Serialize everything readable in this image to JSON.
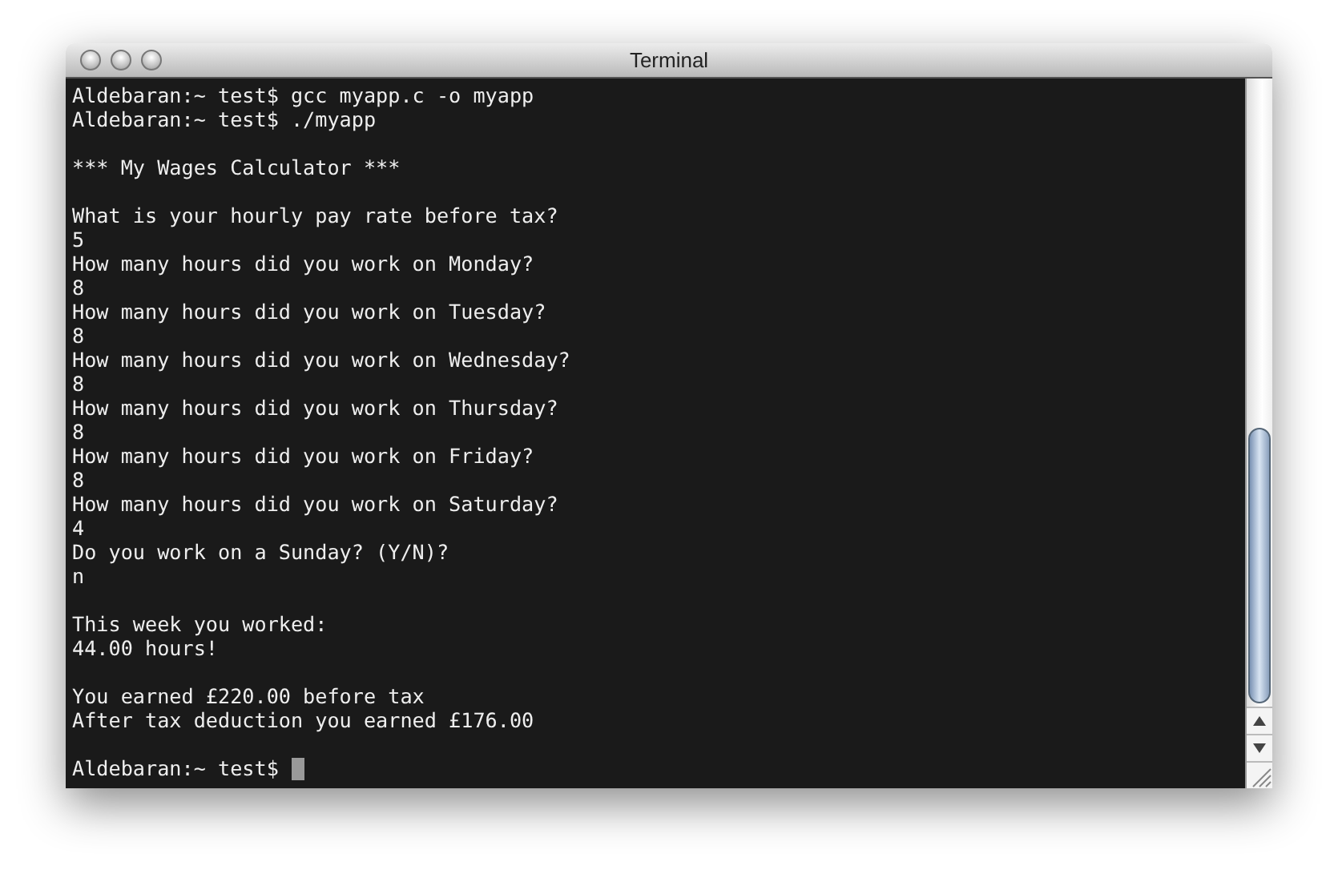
{
  "window": {
    "title": "Terminal"
  },
  "terminal": {
    "blocks": [
      [
        "Aldebaran:~ test$ gcc myapp.c -o myapp",
        "Aldebaran:~ test$ ./myapp"
      ],
      [
        "*** My Wages Calculator ***"
      ],
      [
        "What is your hourly pay rate before tax?",
        "5",
        "How many hours did you work on Monday?",
        "8",
        "How many hours did you work on Tuesday?",
        "8",
        "How many hours did you work on Wednesday?",
        "8",
        "How many hours did you work on Thursday?",
        "8",
        "How many hours did you work on Friday?",
        "8",
        "How many hours did you work on Saturday?",
        "4",
        "Do you work on a Sunday? (Y/N)?",
        "n"
      ],
      [
        "This week you worked:",
        "44.00 hours!"
      ],
      [
        "You earned £220.00 before tax",
        "After tax deduction you earned £176.00"
      ]
    ],
    "prompt": "Aldebaran:~ test$"
  }
}
